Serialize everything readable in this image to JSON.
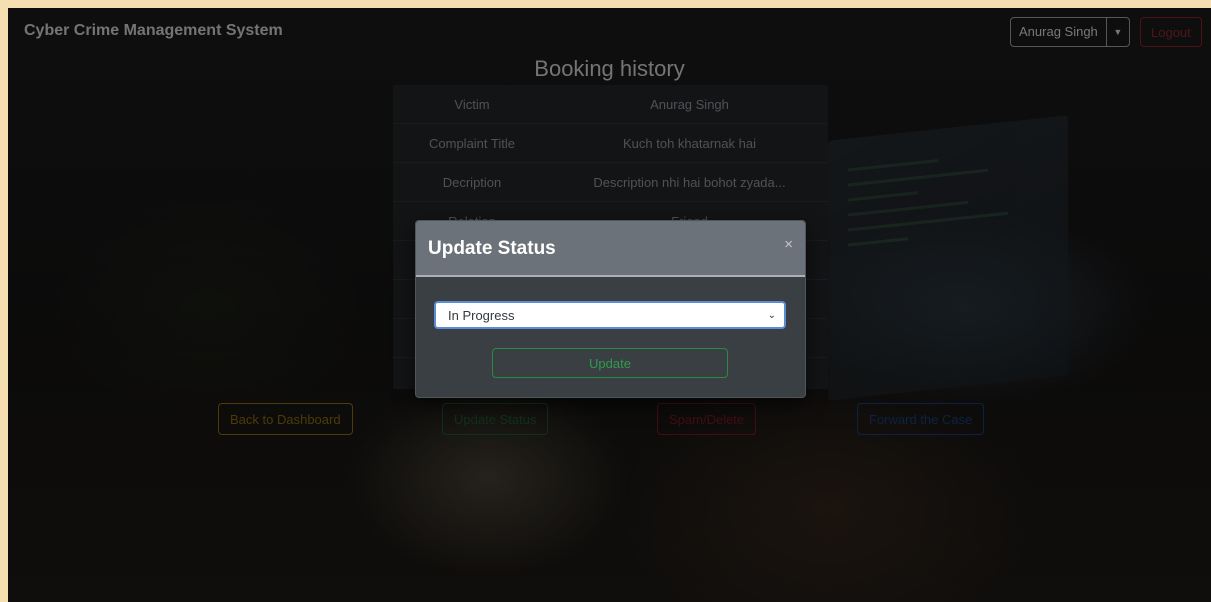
{
  "navbar": {
    "brand": "Cyber Crime Management System",
    "user_name": "Anurag Singh",
    "dropdown_icon": "caret-down-icon",
    "logout_label": "Logout"
  },
  "main": {
    "title": "Booking history",
    "rows": [
      {
        "label": "Victim",
        "value": "Anurag Singh"
      },
      {
        "label": "Complaint Title",
        "value": "Kuch toh khatarnak hai"
      },
      {
        "label": "Decription",
        "value": "Description nhi hai bohot zyada..."
      },
      {
        "label": "Relation",
        "value": "Friend"
      }
    ],
    "buttons": {
      "back": "Back to Dashboard",
      "update_status": "Update Status",
      "spam_delete": "Spam/Delete",
      "forward": "Forward the Case"
    }
  },
  "modal": {
    "title": "Update Status",
    "close": "×",
    "select_value": "In Progress",
    "select_icon": "chevron-down-icon",
    "update_label": "Update"
  },
  "colors": {
    "warning": "#8b6b10",
    "success": "#2f9b4a",
    "danger": "#7a1a22",
    "primary": "#163f7a"
  }
}
